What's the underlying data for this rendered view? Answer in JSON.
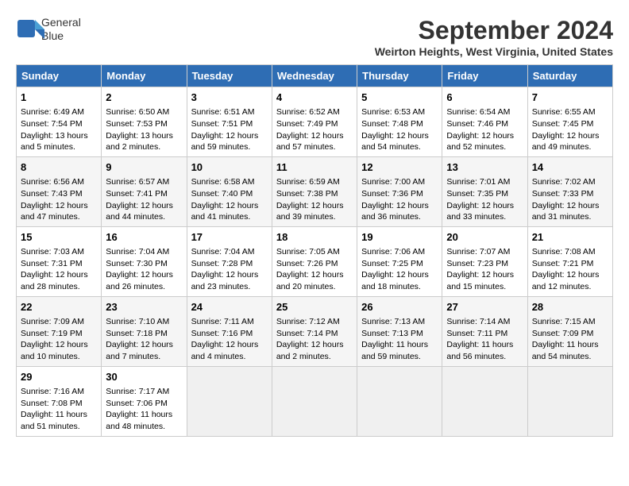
{
  "logo": {
    "line1": "General",
    "line2": "Blue"
  },
  "title": "September 2024",
  "subtitle": "Weirton Heights, West Virginia, United States",
  "header_days": [
    "Sunday",
    "Monday",
    "Tuesday",
    "Wednesday",
    "Thursday",
    "Friday",
    "Saturday"
  ],
  "weeks": [
    [
      {
        "day": "1",
        "lines": [
          "Sunrise: 6:49 AM",
          "Sunset: 7:54 PM",
          "Daylight: 13 hours",
          "and 5 minutes."
        ]
      },
      {
        "day": "2",
        "lines": [
          "Sunrise: 6:50 AM",
          "Sunset: 7:53 PM",
          "Daylight: 13 hours",
          "and 2 minutes."
        ]
      },
      {
        "day": "3",
        "lines": [
          "Sunrise: 6:51 AM",
          "Sunset: 7:51 PM",
          "Daylight: 12 hours",
          "and 59 minutes."
        ]
      },
      {
        "day": "4",
        "lines": [
          "Sunrise: 6:52 AM",
          "Sunset: 7:49 PM",
          "Daylight: 12 hours",
          "and 57 minutes."
        ]
      },
      {
        "day": "5",
        "lines": [
          "Sunrise: 6:53 AM",
          "Sunset: 7:48 PM",
          "Daylight: 12 hours",
          "and 54 minutes."
        ]
      },
      {
        "day": "6",
        "lines": [
          "Sunrise: 6:54 AM",
          "Sunset: 7:46 PM",
          "Daylight: 12 hours",
          "and 52 minutes."
        ]
      },
      {
        "day": "7",
        "lines": [
          "Sunrise: 6:55 AM",
          "Sunset: 7:45 PM",
          "Daylight: 12 hours",
          "and 49 minutes."
        ]
      }
    ],
    [
      {
        "day": "8",
        "lines": [
          "Sunrise: 6:56 AM",
          "Sunset: 7:43 PM",
          "Daylight: 12 hours",
          "and 47 minutes."
        ]
      },
      {
        "day": "9",
        "lines": [
          "Sunrise: 6:57 AM",
          "Sunset: 7:41 PM",
          "Daylight: 12 hours",
          "and 44 minutes."
        ]
      },
      {
        "day": "10",
        "lines": [
          "Sunrise: 6:58 AM",
          "Sunset: 7:40 PM",
          "Daylight: 12 hours",
          "and 41 minutes."
        ]
      },
      {
        "day": "11",
        "lines": [
          "Sunrise: 6:59 AM",
          "Sunset: 7:38 PM",
          "Daylight: 12 hours",
          "and 39 minutes."
        ]
      },
      {
        "day": "12",
        "lines": [
          "Sunrise: 7:00 AM",
          "Sunset: 7:36 PM",
          "Daylight: 12 hours",
          "and 36 minutes."
        ]
      },
      {
        "day": "13",
        "lines": [
          "Sunrise: 7:01 AM",
          "Sunset: 7:35 PM",
          "Daylight: 12 hours",
          "and 33 minutes."
        ]
      },
      {
        "day": "14",
        "lines": [
          "Sunrise: 7:02 AM",
          "Sunset: 7:33 PM",
          "Daylight: 12 hours",
          "and 31 minutes."
        ]
      }
    ],
    [
      {
        "day": "15",
        "lines": [
          "Sunrise: 7:03 AM",
          "Sunset: 7:31 PM",
          "Daylight: 12 hours",
          "and 28 minutes."
        ]
      },
      {
        "day": "16",
        "lines": [
          "Sunrise: 7:04 AM",
          "Sunset: 7:30 PM",
          "Daylight: 12 hours",
          "and 26 minutes."
        ]
      },
      {
        "day": "17",
        "lines": [
          "Sunrise: 7:04 AM",
          "Sunset: 7:28 PM",
          "Daylight: 12 hours",
          "and 23 minutes."
        ]
      },
      {
        "day": "18",
        "lines": [
          "Sunrise: 7:05 AM",
          "Sunset: 7:26 PM",
          "Daylight: 12 hours",
          "and 20 minutes."
        ]
      },
      {
        "day": "19",
        "lines": [
          "Sunrise: 7:06 AM",
          "Sunset: 7:25 PM",
          "Daylight: 12 hours",
          "and 18 minutes."
        ]
      },
      {
        "day": "20",
        "lines": [
          "Sunrise: 7:07 AM",
          "Sunset: 7:23 PM",
          "Daylight: 12 hours",
          "and 15 minutes."
        ]
      },
      {
        "day": "21",
        "lines": [
          "Sunrise: 7:08 AM",
          "Sunset: 7:21 PM",
          "Daylight: 12 hours",
          "and 12 minutes."
        ]
      }
    ],
    [
      {
        "day": "22",
        "lines": [
          "Sunrise: 7:09 AM",
          "Sunset: 7:19 PM",
          "Daylight: 12 hours",
          "and 10 minutes."
        ]
      },
      {
        "day": "23",
        "lines": [
          "Sunrise: 7:10 AM",
          "Sunset: 7:18 PM",
          "Daylight: 12 hours",
          "and 7 minutes."
        ]
      },
      {
        "day": "24",
        "lines": [
          "Sunrise: 7:11 AM",
          "Sunset: 7:16 PM",
          "Daylight: 12 hours",
          "and 4 minutes."
        ]
      },
      {
        "day": "25",
        "lines": [
          "Sunrise: 7:12 AM",
          "Sunset: 7:14 PM",
          "Daylight: 12 hours",
          "and 2 minutes."
        ]
      },
      {
        "day": "26",
        "lines": [
          "Sunrise: 7:13 AM",
          "Sunset: 7:13 PM",
          "Daylight: 11 hours",
          "and 59 minutes."
        ]
      },
      {
        "day": "27",
        "lines": [
          "Sunrise: 7:14 AM",
          "Sunset: 7:11 PM",
          "Daylight: 11 hours",
          "and 56 minutes."
        ]
      },
      {
        "day": "28",
        "lines": [
          "Sunrise: 7:15 AM",
          "Sunset: 7:09 PM",
          "Daylight: 11 hours",
          "and 54 minutes."
        ]
      }
    ],
    [
      {
        "day": "29",
        "lines": [
          "Sunrise: 7:16 AM",
          "Sunset: 7:08 PM",
          "Daylight: 11 hours",
          "and 51 minutes."
        ]
      },
      {
        "day": "30",
        "lines": [
          "Sunrise: 7:17 AM",
          "Sunset: 7:06 PM",
          "Daylight: 11 hours",
          "and 48 minutes."
        ]
      },
      null,
      null,
      null,
      null,
      null
    ]
  ]
}
